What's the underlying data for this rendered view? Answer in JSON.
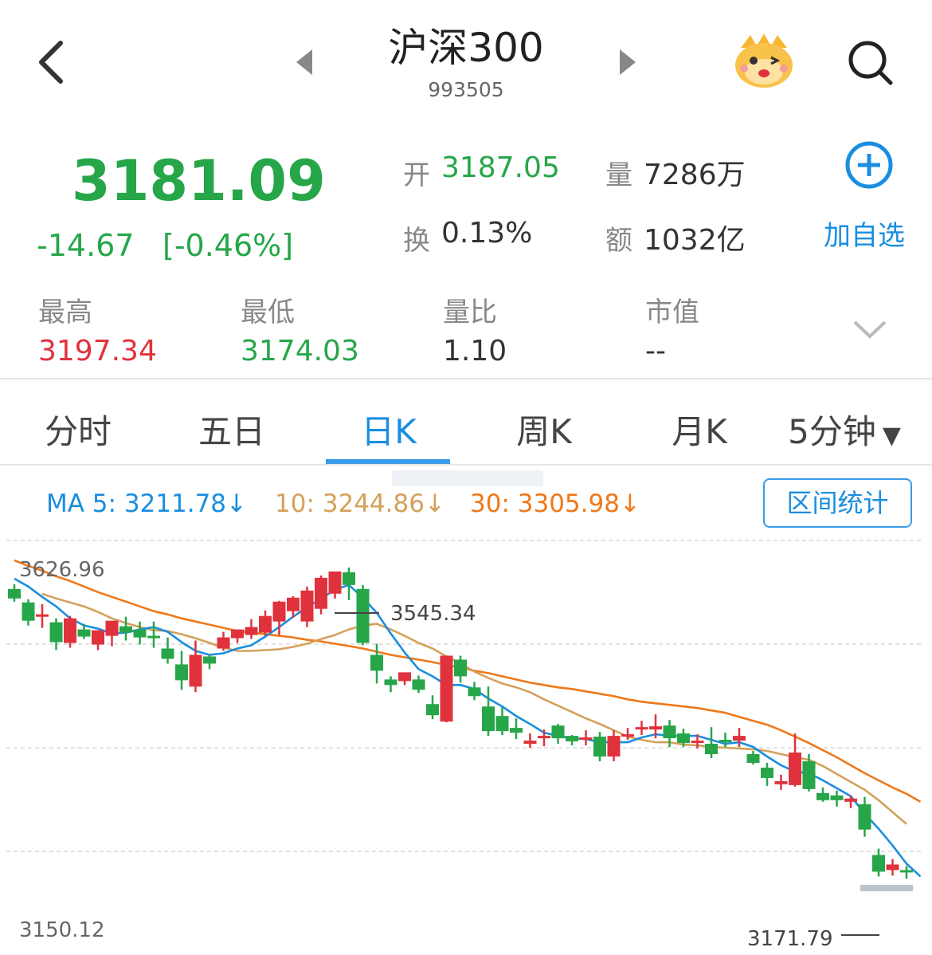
{
  "header": {
    "title": "沪深300",
    "code": "993505"
  },
  "quote": {
    "price": "3181.09",
    "change": "-14.67",
    "change_pct": "[-0.46%]",
    "stats": [
      {
        "label": "开",
        "value": "3187.05",
        "color": "#26a649"
      },
      {
        "label": "量",
        "value": "7286万",
        "color": "#333333"
      },
      {
        "label": "换",
        "value": "0.13%",
        "color": "#333333"
      },
      {
        "label": "额",
        "value": "1032亿",
        "color": "#333333"
      }
    ],
    "add_label": "加自选",
    "extra": [
      {
        "label": "最高",
        "value": "3197.34",
        "color": "#e0323c"
      },
      {
        "label": "最低",
        "value": "3174.03",
        "color": "#26a649"
      },
      {
        "label": "量比",
        "value": "1.10",
        "color": "#333333"
      },
      {
        "label": "市值",
        "value": "--",
        "color": "#333333"
      }
    ]
  },
  "tabs": [
    "分时",
    "五日",
    "日K",
    "周K",
    "月K",
    "5分钟"
  ],
  "active_tab": "日K",
  "ma": {
    "ma5": "MA 5: 3211.78↓",
    "ma10": "10: 3244.86↓",
    "ma30": "30: 3305.98↓",
    "colors": {
      "ma5": "#1a8ee0",
      "ma10": "#d4a15a",
      "ma30": "#f07818"
    }
  },
  "range_button": "区间统计",
  "colors": {
    "up": "#e0323c",
    "down": "#26a649",
    "accent": "#1a8ee0"
  },
  "chart_data": {
    "type": "candlestick",
    "y_top_label": "3626.96",
    "y_bottom_label": "3150.12",
    "high_label": "3545.34",
    "low_label": "3171.79",
    "ylim": [
      3150.12,
      3626.96
    ],
    "candles": [
      [
        3588,
        3594,
        3576,
        3572,
        "d"
      ],
      [
        3571,
        3575,
        3548,
        3542,
        "d"
      ],
      [
        3555,
        3569,
        3556,
        3539,
        "u"
      ],
      [
        3546,
        3551,
        3521,
        3511,
        "d"
      ],
      [
        3520,
        3554,
        3551,
        3514,
        "u"
      ],
      [
        3537,
        3544,
        3528,
        3525,
        "d"
      ],
      [
        3518,
        3534,
        3536,
        3511,
        "u"
      ],
      [
        3529,
        3536,
        3548,
        3516,
        "u"
      ],
      [
        3533,
        3553,
        3541,
        3523,
        "d"
      ],
      [
        3537,
        3547,
        3527,
        3518,
        "d"
      ],
      [
        3529,
        3547,
        3527,
        3514,
        "d"
      ],
      [
        3513,
        3527,
        3500,
        3494,
        "d"
      ],
      [
        3493,
        3510,
        3473,
        3461,
        "d"
      ],
      [
        3465,
        3523,
        3505,
        3458,
        "u"
      ],
      [
        3503,
        3505,
        3494,
        3487,
        "d"
      ],
      [
        3513,
        3534,
        3527,
        3510,
        "u"
      ],
      [
        3526,
        3537,
        3537,
        3520,
        "u"
      ],
      [
        3530,
        3550,
        3540,
        3525,
        "u"
      ],
      [
        3533,
        3561,
        3554,
        3529,
        "u"
      ],
      [
        3547,
        3573,
        3572,
        3530,
        "u"
      ],
      [
        3560,
        3579,
        3577,
        3552,
        "u"
      ],
      [
        3547,
        3591,
        3586,
        3540,
        "u"
      ],
      [
        3563,
        3605,
        3602,
        3556,
        "u"
      ],
      [
        3582,
        3609,
        3610,
        3576,
        "u"
      ],
      [
        3609,
        3615,
        3593,
        3574,
        "d"
      ],
      [
        3588,
        3593,
        3520,
        3517,
        "d"
      ],
      [
        3505,
        3519,
        3485,
        3469,
        "d"
      ],
      [
        3474,
        3478,
        3467,
        3458,
        "d"
      ],
      [
        3472,
        3480,
        3483,
        3467,
        "u"
      ],
      [
        3474,
        3479,
        3461,
        3457,
        "d"
      ],
      [
        3443,
        3454,
        3429,
        3424,
        "d"
      ],
      [
        3421,
        3499,
        3504,
        3420,
        "u"
      ],
      [
        3499,
        3504,
        3478,
        3470,
        "d"
      ],
      [
        3464,
        3471,
        3453,
        3448,
        "d"
      ],
      [
        3440,
        3465,
        3409,
        3403,
        "d"
      ],
      [
        3428,
        3439,
        3409,
        3404,
        "d"
      ],
      [
        3413,
        3425,
        3407,
        3399,
        "d"
      ],
      [
        3393,
        3406,
        3397,
        3388,
        "u"
      ],
      [
        3403,
        3411,
        3402,
        3390,
        "u"
      ],
      [
        3416,
        3418,
        3400,
        3393,
        "d"
      ],
      [
        3403,
        3404,
        3396,
        3391,
        "d"
      ],
      [
        3399,
        3410,
        3401,
        3391,
        "u"
      ],
      [
        3402,
        3408,
        3377,
        3371,
        "d"
      ],
      [
        3377,
        3410,
        3403,
        3371,
        "u"
      ],
      [
        3404,
        3413,
        3405,
        3398,
        "u"
      ],
      [
        3414,
        3422,
        3412,
        3404,
        "u"
      ],
      [
        3411,
        3430,
        3415,
        3400,
        "u"
      ],
      [
        3416,
        3423,
        3400,
        3389,
        "d"
      ],
      [
        3406,
        3412,
        3394,
        3389,
        "d"
      ],
      [
        3397,
        3405,
        3396,
        3387,
        "u"
      ],
      [
        3393,
        3414,
        3380,
        3375,
        "d"
      ],
      [
        3398,
        3407,
        3396,
        3389,
        "d"
      ],
      [
        3397,
        3413,
        3403,
        3389,
        "u"
      ],
      [
        3380,
        3384,
        3369,
        3367,
        "d"
      ],
      [
        3363,
        3369,
        3350,
        3340,
        "d"
      ],
      [
        3342,
        3354,
        3346,
        3335,
        "u"
      ],
      [
        3341,
        3406,
        3382,
        3339,
        "u"
      ],
      [
        3371,
        3380,
        3336,
        3333,
        "d"
      ],
      [
        3331,
        3338,
        3322,
        3320,
        "d"
      ],
      [
        3328,
        3334,
        3322,
        3314,
        "d"
      ],
      [
        3320,
        3328,
        3324,
        3312,
        "u"
      ],
      [
        3317,
        3326,
        3285,
        3276,
        "d"
      ],
      [
        3253,
        3261,
        3232,
        3226,
        "d"
      ],
      [
        3234,
        3248,
        3241,
        3227,
        "u"
      ],
      [
        3231,
        3239,
        3234,
        3223,
        "d"
      ]
    ],
    "ma5": [
      3601,
      3591,
      3578,
      3566,
      3551,
      3542,
      3538,
      3532,
      3533,
      3537,
      3540,
      3534,
      3521,
      3510,
      3505,
      3507,
      3513,
      3517,
      3528,
      3540,
      3553,
      3565,
      3576,
      3587,
      3593,
      3577,
      3558,
      3532,
      3508,
      3487,
      3478,
      3467,
      3467,
      3462,
      3450,
      3440,
      3428,
      3418,
      3407,
      3403,
      3400,
      3399,
      3395,
      3395,
      3395,
      3401,
      3405,
      3403,
      3403,
      3403,
      3398,
      3393,
      3395,
      3389,
      3377,
      3366,
      3358,
      3356,
      3347,
      3337,
      3327,
      3305,
      3286,
      3265,
      3242,
      3226
    ],
    "ma10": [
      3582,
      3576,
      3571,
      3566,
      3559,
      3551,
      3545,
      3540,
      3536,
      3535,
      3531,
      3526,
      3520,
      3514,
      3510,
      3510,
      3511,
      3512,
      3515,
      3519,
      3525,
      3530,
      3537,
      3542,
      3544,
      3537,
      3529,
      3520,
      3513,
      3503,
      3494,
      3484,
      3476,
      3469,
      3464,
      3458,
      3449,
      3441,
      3433,
      3425,
      3418,
      3410,
      3402,
      3398,
      3395,
      3395,
      3392,
      3391,
      3389,
      3388,
      3387,
      3386,
      3384,
      3380,
      3376,
      3373,
      3365,
      3355,
      3345,
      3335,
      3322,
      3307,
      3292
    ],
    "ma30": [
      3624,
      3617,
      3611,
      3604,
      3598,
      3591,
      3584,
      3578,
      3572,
      3566,
      3560,
      3556,
      3551,
      3547,
      3543,
      3539,
      3535,
      3533,
      3531,
      3529,
      3527,
      3524,
      3522,
      3519,
      3516,
      3513,
      3509,
      3505,
      3502,
      3499,
      3496,
      3492,
      3489,
      3485,
      3482,
      3478,
      3474,
      3470,
      3467,
      3464,
      3462,
      3459,
      3456,
      3453,
      3449,
      3446,
      3444,
      3442,
      3440,
      3438,
      3435,
      3432,
      3427,
      3422,
      3417,
      3410,
      3402,
      3394,
      3385,
      3376,
      3366,
      3356,
      3347,
      3338,
      3330,
      3320
    ]
  }
}
